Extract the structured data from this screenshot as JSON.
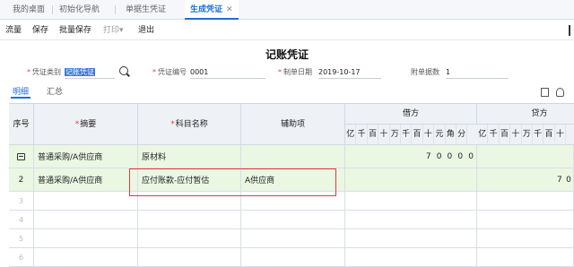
{
  "tabs": [
    {
      "label": "我的桌面",
      "active": false
    },
    {
      "label": "初始化导航",
      "active": false
    },
    {
      "label": "单据生凭证",
      "active": false
    },
    {
      "label": "生成凭证",
      "active": true,
      "closable": true
    }
  ],
  "toolbar": {
    "items": [
      "流量",
      "保存",
      "批量保存",
      "打印",
      "退出"
    ],
    "print_dropdown": "▾"
  },
  "voucher": {
    "title": "记账凭证",
    "type_label": "凭证类别",
    "type_value": "记账凭证",
    "number_label": "凭证编号",
    "number_value": "0001",
    "date_label": "制单日期",
    "date_value": "2019-10-17",
    "attach_label": "附单据数",
    "attach_value": "1"
  },
  "subtabs": [
    "明细",
    "汇总"
  ],
  "grid": {
    "headers": {
      "seq": "序号",
      "summary": "摘要",
      "account": "科目名称",
      "aux": "辅助项",
      "debit": "借方",
      "credit": "贷方"
    },
    "debit_digits": [
      "亿",
      "千",
      "百",
      "十",
      "万",
      "千",
      "百",
      "十",
      "元",
      "角",
      "分"
    ],
    "credit_digits": [
      "亿",
      "千",
      "百",
      "十",
      "万",
      "千",
      "百",
      "十"
    ],
    "rows": [
      {
        "no": "",
        "summary": "普通采购/A供应商",
        "account": "原材料",
        "aux": "",
        "debit": [
          "7",
          "0",
          "0",
          "0",
          "0"
        ],
        "credit": []
      },
      {
        "no": "2",
        "summary": "普通采购/A供应商",
        "account": "应付账款-应付暂估",
        "aux": "A供应商",
        "debit": [],
        "credit": [
          "7",
          "0"
        ]
      },
      {
        "no": "3"
      },
      {
        "no": "4"
      },
      {
        "no": "5"
      },
      {
        "no": "6"
      }
    ]
  },
  "colors": {
    "accent": "#1e6fd9",
    "row_highlight": "#eaf7e3",
    "annotation": "#e53935",
    "required": "#e0473d"
  }
}
